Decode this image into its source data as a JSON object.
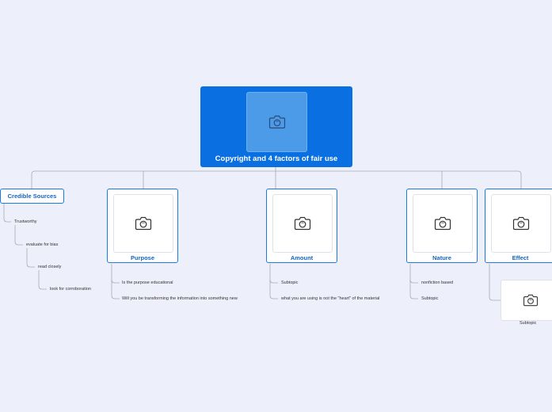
{
  "root": {
    "title": "Copyright and 4 factors of fair use",
    "icon": "camera-icon"
  },
  "credible": {
    "label": "Credible Sources",
    "chain": [
      "Trustworthy",
      "evaluate for bias",
      "read closely",
      "look for corroboration"
    ]
  },
  "cards": {
    "purpose": {
      "label": "Purpose",
      "items": [
        "Is the purpose educational",
        "Will you be transforming the information into something new"
      ]
    },
    "amount": {
      "label": "Amount",
      "items": [
        "Subtopic",
        "what you are using is not the \"heart\" of the material"
      ]
    },
    "nature": {
      "label": "Nature",
      "items": [
        "nonfiction based",
        "Subtopic"
      ]
    },
    "effect": {
      "label": "Effect",
      "sub_label": "Subtopic"
    }
  },
  "colors": {
    "accent": "#0a6fe0",
    "border": "#1b79e3",
    "line": "#a6aab4",
    "background": "#edf0fb"
  }
}
